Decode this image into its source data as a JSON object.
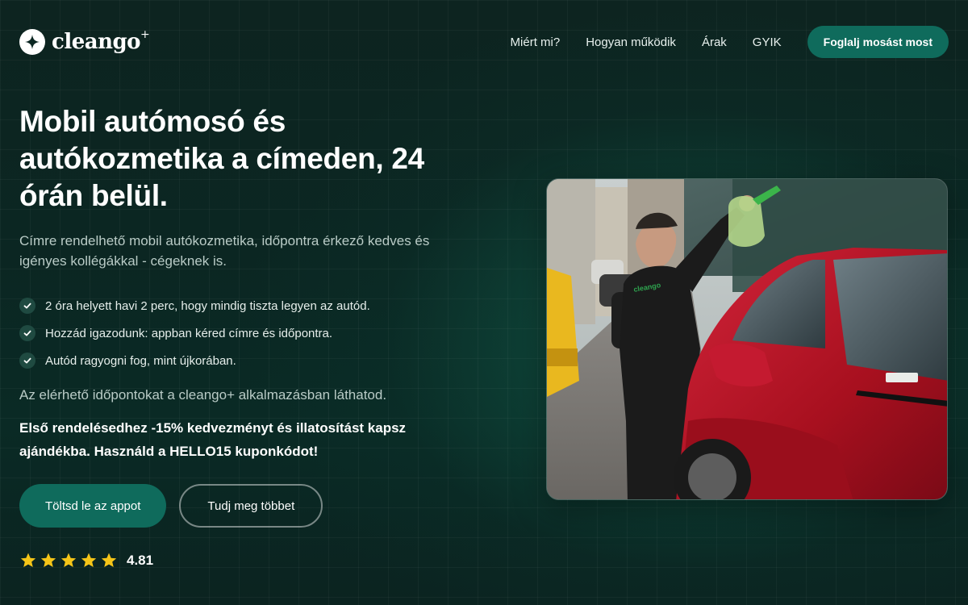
{
  "brand": {
    "name": "cleango",
    "suffix": "+"
  },
  "nav": {
    "items": [
      {
        "label": "Miért mi?"
      },
      {
        "label": "Hogyan működik"
      },
      {
        "label": "Árak"
      },
      {
        "label": "GYIK"
      }
    ],
    "cta_label": "Foglalj mosást most"
  },
  "hero": {
    "title": "Mobil autómosó és autókozmetika a címeden, 24 órán belül.",
    "lead": "Címre rendelhető mobil autókozmetika, időpontra érkező kedves és igényes kollégákkal - cégeknek is.",
    "features": [
      "2 óra helyett havi 2 perc, hogy mindig tiszta legyen az autód.",
      "Hozzád igazodunk: appban kéred címre és időpontra.",
      "Autód ragyogni fog, mint újkorában."
    ],
    "availability": "Az elérhető időpontokat a cleango+ alkalmazásban láthatod.",
    "promo": "Első rendelésedhez -15% kedvezményt és illatosítást kapsz ajándékba. Használd a HELLO15 kuponkódot!",
    "primary_button": "Töltsd le az appot",
    "secondary_button": "Tudj meg többet",
    "rating": {
      "stars": 5,
      "value": "4.81"
    }
  },
  "image": {
    "vest_text": "cleango"
  },
  "colors": {
    "accent": "#0f6b5c",
    "star": "#f5c518",
    "background": "#0b2622",
    "car": "#b8142a"
  }
}
